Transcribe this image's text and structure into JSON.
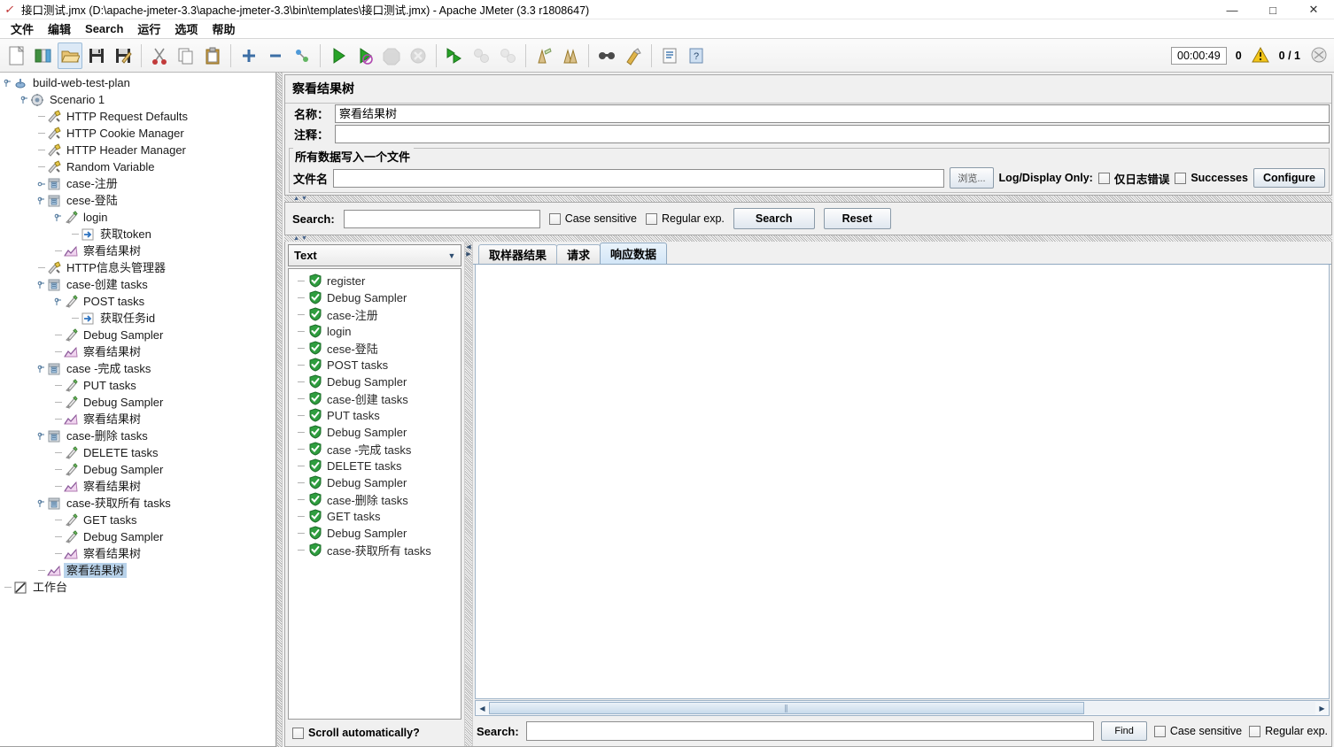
{
  "window": {
    "title": "接口测试.jmx (D:\\apache-jmeter-3.3\\apache-jmeter-3.3\\bin\\templates\\接口测试.jmx) - Apache JMeter (3.3 r1808647)",
    "minimize": "—",
    "maximize": "□",
    "close": "✕"
  },
  "menubar": {
    "items": [
      {
        "label": "文件",
        "name": "menu-file"
      },
      {
        "label": "编辑",
        "name": "menu-edit"
      },
      {
        "label": "Search",
        "name": "menu-search"
      },
      {
        "label": "运行",
        "name": "menu-run"
      },
      {
        "label": "选项",
        "name": "menu-options"
      },
      {
        "label": "帮助",
        "name": "menu-help"
      }
    ]
  },
  "toolbar": {
    "status": {
      "timer": "00:00:49",
      "warnings": "0",
      "threads": "0 / 1"
    },
    "icons": [
      "new-icon",
      "templates-icon",
      "open-icon",
      "save-icon",
      "save-as-icon",
      "cut-icon",
      "copy-icon",
      "paste-icon",
      "expand-icon",
      "collapse-icon",
      "toggle-icon",
      "start-icon",
      "start-no-pauses-icon",
      "stop-icon",
      "shutdown-icon",
      "remote-start-all-icon",
      "remote-stop-all-icon",
      "remote-shutdown-all-icon",
      "clear-icon",
      "clear-all-icon",
      "search-icon",
      "search-reset-icon",
      "function-helper-icon",
      "help-icon"
    ]
  },
  "tree": {
    "nodes": [
      {
        "label": "build-web-test-plan",
        "indent": 0,
        "icon": "test-plan-icon",
        "toggle": "expanded",
        "selected": false
      },
      {
        "label": "Scenario 1",
        "indent": 1,
        "icon": "thread-group-icon",
        "toggle": "expanded",
        "selected": false
      },
      {
        "label": "HTTP Request Defaults",
        "indent": 2,
        "icon": "config-element-icon",
        "toggle": "none",
        "selected": false
      },
      {
        "label": "HTTP Cookie Manager",
        "indent": 2,
        "icon": "config-element-icon",
        "toggle": "none",
        "selected": false
      },
      {
        "label": "HTTP Header Manager",
        "indent": 2,
        "icon": "config-element-icon",
        "toggle": "none",
        "selected": false
      },
      {
        "label": "Random Variable",
        "indent": 2,
        "icon": "config-element-icon",
        "toggle": "none",
        "selected": false
      },
      {
        "label": "case-注册",
        "indent": 2,
        "icon": "controller-icon",
        "toggle": "collapsed",
        "selected": false
      },
      {
        "label": "cese-登陆",
        "indent": 2,
        "icon": "controller-icon",
        "toggle": "expanded",
        "selected": false
      },
      {
        "label": "login",
        "indent": 3,
        "icon": "sampler-icon",
        "toggle": "expanded",
        "selected": false
      },
      {
        "label": "获取token",
        "indent": 4,
        "icon": "post-processor-icon",
        "toggle": "none",
        "selected": false
      },
      {
        "label": "察看结果树",
        "indent": 3,
        "icon": "view-results-tree-icon",
        "toggle": "none",
        "selected": false
      },
      {
        "label": "HTTP信息头管理器",
        "indent": 2,
        "icon": "config-element-icon",
        "toggle": "none",
        "selected": false
      },
      {
        "label": "case-创建 tasks",
        "indent": 2,
        "icon": "controller-icon",
        "toggle": "expanded",
        "selected": false
      },
      {
        "label": "POST tasks",
        "indent": 3,
        "icon": "sampler-icon",
        "toggle": "expanded",
        "selected": false
      },
      {
        "label": "获取任务id",
        "indent": 4,
        "icon": "post-processor-icon",
        "toggle": "none",
        "selected": false
      },
      {
        "label": "Debug Sampler",
        "indent": 3,
        "icon": "sampler-icon",
        "toggle": "none",
        "selected": false
      },
      {
        "label": "察看结果树",
        "indent": 3,
        "icon": "view-results-tree-icon",
        "toggle": "none",
        "selected": false
      },
      {
        "label": "case -完成 tasks",
        "indent": 2,
        "icon": "controller-icon",
        "toggle": "expanded",
        "selected": false
      },
      {
        "label": "PUT tasks",
        "indent": 3,
        "icon": "sampler-icon",
        "toggle": "none",
        "selected": false
      },
      {
        "label": "Debug Sampler",
        "indent": 3,
        "icon": "sampler-icon",
        "toggle": "none",
        "selected": false
      },
      {
        "label": "察看结果树",
        "indent": 3,
        "icon": "view-results-tree-icon",
        "toggle": "none",
        "selected": false
      },
      {
        "label": "case-删除 tasks",
        "indent": 2,
        "icon": "controller-icon",
        "toggle": "expanded",
        "selected": false
      },
      {
        "label": "DELETE  tasks",
        "indent": 3,
        "icon": "sampler-icon",
        "toggle": "none",
        "selected": false
      },
      {
        "label": "Debug Sampler",
        "indent": 3,
        "icon": "sampler-icon",
        "toggle": "none",
        "selected": false
      },
      {
        "label": "察看结果树",
        "indent": 3,
        "icon": "view-results-tree-icon",
        "toggle": "none",
        "selected": false
      },
      {
        "label": "case-获取所有 tasks",
        "indent": 2,
        "icon": "controller-icon",
        "toggle": "expanded",
        "selected": false
      },
      {
        "label": "GET tasks",
        "indent": 3,
        "icon": "sampler-icon",
        "toggle": "none",
        "selected": false
      },
      {
        "label": "Debug Sampler",
        "indent": 3,
        "icon": "sampler-icon",
        "toggle": "none",
        "selected": false
      },
      {
        "label": "察看结果树",
        "indent": 3,
        "icon": "view-results-tree-icon",
        "toggle": "none",
        "selected": false
      },
      {
        "label": "察看结果树",
        "indent": 2,
        "icon": "view-results-tree-icon",
        "toggle": "none",
        "selected": true
      },
      {
        "label": "工作台",
        "indent": 0,
        "icon": "workbench-icon",
        "toggle": "none",
        "selected": false
      }
    ]
  },
  "panel": {
    "title": "察看结果树",
    "name_label": "名称：",
    "name_value": "察看结果树",
    "comment_label": "注释：",
    "comment_value": "",
    "group_title": "所有数据写入一个文件",
    "filename_label": "文件名",
    "filename_value": "",
    "browse_button": "浏览...",
    "log_display_label": "Log/Display Only:",
    "errors_only_label": "仅日志错误",
    "successes_label": "Successes",
    "configure_button": "Configure"
  },
  "search_bar": {
    "label": "Search:",
    "value": "",
    "case_sensitive": "Case sensitive",
    "regular_exp": "Regular exp.",
    "search_button": "Search",
    "reset_button": "Reset"
  },
  "results": {
    "render_combo_value": "Text",
    "scroll_auto_label": "Scroll automatically?",
    "items": [
      {
        "label": "register",
        "status": "success"
      },
      {
        "label": "Debug Sampler",
        "status": "success"
      },
      {
        "label": "case-注册",
        "status": "success"
      },
      {
        "label": "login",
        "status": "success"
      },
      {
        "label": "cese-登陆",
        "status": "success"
      },
      {
        "label": "POST tasks",
        "status": "success"
      },
      {
        "label": "Debug Sampler",
        "status": "success"
      },
      {
        "label": "case-创建 tasks",
        "status": "success"
      },
      {
        "label": "PUT tasks",
        "status": "success"
      },
      {
        "label": "Debug Sampler",
        "status": "success"
      },
      {
        "label": "case -完成 tasks",
        "status": "success"
      },
      {
        "label": "DELETE  tasks",
        "status": "success"
      },
      {
        "label": "Debug Sampler",
        "status": "success"
      },
      {
        "label": "case-删除 tasks",
        "status": "success"
      },
      {
        "label": "GET tasks",
        "status": "success"
      },
      {
        "label": "Debug Sampler",
        "status": "success"
      },
      {
        "label": "case-获取所有 tasks",
        "status": "success"
      }
    ]
  },
  "tabs": [
    {
      "label": "取样器结果",
      "selected": false
    },
    {
      "label": "请求",
      "selected": false
    },
    {
      "label": "响应数据",
      "selected": true
    }
  ],
  "content": {
    "body": ""
  },
  "bottom_search": {
    "label": "Search:",
    "value": "",
    "find_button": "Find",
    "case_sensitive": "Case sensitive",
    "regular_exp": "Regular exp."
  },
  "colors": {
    "accent": "#b8d2ea",
    "success": "#2f9e3f",
    "warning": "#f0c419",
    "panel_bg": "#f0f0f0"
  }
}
